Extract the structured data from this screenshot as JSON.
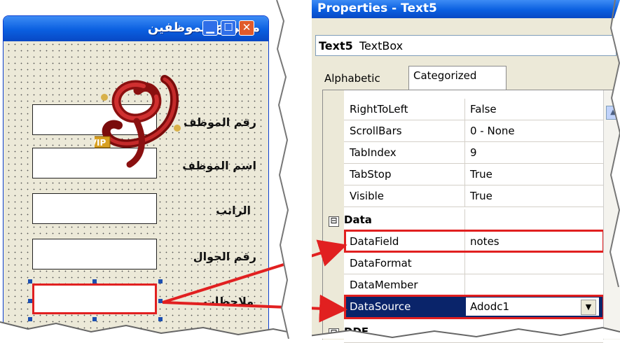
{
  "form_window": {
    "title": "مشروع الموظفين",
    "buttons": {
      "close": "✕",
      "maximize": "☐",
      "minimize": "▁"
    },
    "fields": [
      {
        "label": "رقم الموظف"
      },
      {
        "label": "اسم الموظف"
      },
      {
        "label": "الراتب"
      },
      {
        "label": "رقم الجوال"
      },
      {
        "label": "ملاحظات"
      }
    ],
    "logo_text": "VIP"
  },
  "properties_window": {
    "title": "Properties - Text5",
    "object_combo": {
      "name": "Text5",
      "type": "TextBox"
    },
    "tabs": {
      "alphabetic": "Alphabetic",
      "categorized": "Categorized"
    },
    "rows": [
      {
        "name": "RightToLeft",
        "value": "False"
      },
      {
        "name": "ScrollBars",
        "value": "0 - None"
      },
      {
        "name": "TabIndex",
        "value": "9"
      },
      {
        "name": "TabStop",
        "value": "True"
      },
      {
        "name": "Visible",
        "value": "True"
      }
    ],
    "category_data": {
      "name": "Data",
      "toggle": "⊟"
    },
    "data_rows": [
      {
        "name": "DataField",
        "value": "notes"
      },
      {
        "name": "DataFormat",
        "value": ""
      },
      {
        "name": "DataMember",
        "value": ""
      },
      {
        "name": "DataSource",
        "value": "Adodc1"
      }
    ],
    "category_dde": {
      "name": "DDE",
      "toggle": "⊟"
    },
    "dropdown_glyph": "▼",
    "scroll_up_glyph": "▲"
  },
  "colors": {
    "highlight": "#e12020",
    "title_bar": "#0a5fe0",
    "selection": "#0a246a"
  }
}
